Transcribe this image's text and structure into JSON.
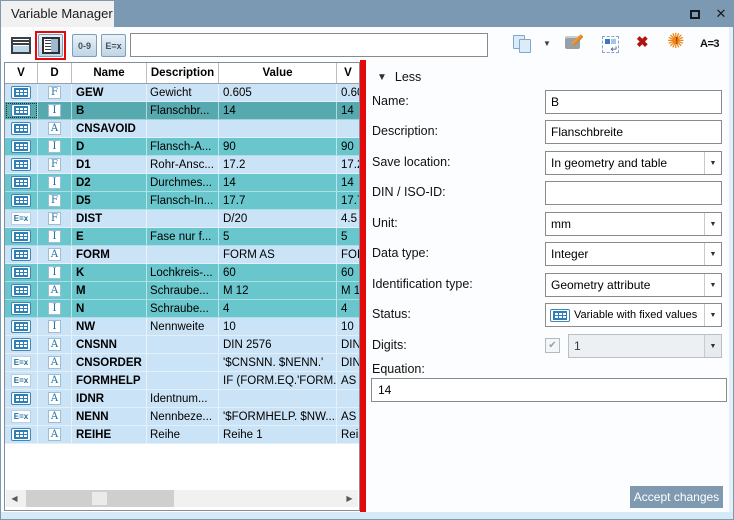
{
  "window": {
    "title": "Variable Manager",
    "close_glyph": "✕"
  },
  "toolbar": {
    "numeric_filter_label": "0-9",
    "equation_filter_label": "E=x",
    "filter_value": "",
    "a3_label": "A=3"
  },
  "icons": {
    "eq_chip_label": "E=x",
    "copy_arrow": "▼",
    "renumber_arrow": "↵",
    "delete_glyph": "✖",
    "star_glyph": "✺",
    "star_mark": "!",
    "less_arrow": "▼",
    "dropdown_arrow": "▼",
    "check_glyph": "✔",
    "scroll_left": "◀",
    "scroll_right": "▶"
  },
  "colors": {
    "annotation_red": "#e20a0a",
    "row_blue": "#cbe3f6",
    "row_teal": "#68c6cc",
    "row_selected": "#57a9b0",
    "titlebar": "#7b99b3",
    "accept_button": "#7e99b0"
  },
  "table": {
    "columns": [
      "V",
      "D",
      "Name",
      "Description",
      "Value",
      "V"
    ],
    "rows": [
      {
        "icon": "table",
        "d": "F",
        "name": "GEW",
        "desc": "Gewicht",
        "value": "0.605",
        "v2": "0.60",
        "style": "blue"
      },
      {
        "icon": "table",
        "d": "I",
        "name": "B",
        "desc": "Flanschbr...",
        "value": "14",
        "v2": "14",
        "style": "selected"
      },
      {
        "icon": "table",
        "d": "A",
        "name": "CNSAVOID",
        "desc": "",
        "value": "",
        "v2": "",
        "style": "blue"
      },
      {
        "icon": "table",
        "d": "I",
        "name": "D",
        "desc": "Flansch-A...",
        "value": "90",
        "v2": "90",
        "style": "teal"
      },
      {
        "icon": "table",
        "d": "F",
        "name": "D1",
        "desc": "Rohr-Ansc...",
        "value": "17.2",
        "v2": "17.2",
        "style": "blue"
      },
      {
        "icon": "table",
        "d": "I",
        "name": "D2",
        "desc": "Durchmes...",
        "value": "14",
        "v2": "14",
        "style": "teal"
      },
      {
        "icon": "table",
        "d": "F",
        "name": "D5",
        "desc": "Flansch-In...",
        "value": "17.7",
        "v2": "17.7",
        "style": "teal"
      },
      {
        "icon": "eq",
        "d": "F",
        "name": "DIST",
        "desc": "",
        "value": "D/20",
        "v2": "4.5",
        "style": "blue"
      },
      {
        "icon": "table",
        "d": "I",
        "name": "E",
        "desc": "Fase nur f...",
        "value": "5",
        "v2": "5",
        "style": "teal"
      },
      {
        "icon": "table",
        "d": "A",
        "name": "FORM",
        "desc": "",
        "value": "FORM AS",
        "v2": "FOR",
        "style": "blue"
      },
      {
        "icon": "table",
        "d": "I",
        "name": "K",
        "desc": "Lochkreis-...",
        "value": "60",
        "v2": "60",
        "style": "teal"
      },
      {
        "icon": "table",
        "d": "A",
        "name": "M",
        "desc": "Schraube...",
        "value": "M 12",
        "v2": "M 1",
        "style": "teal"
      },
      {
        "icon": "table",
        "d": "I",
        "name": "N",
        "desc": "Schraube...",
        "value": "4",
        "v2": "4",
        "style": "teal"
      },
      {
        "icon": "table",
        "d": "I",
        "name": "NW",
        "desc": "Nennweite",
        "value": "10",
        "v2": "10",
        "style": "blue"
      },
      {
        "icon": "table",
        "d": "A",
        "name": "CNSNN",
        "desc": "",
        "value": "DIN 2576",
        "v2": "DIN",
        "style": "blue"
      },
      {
        "icon": "eq",
        "d": "A",
        "name": "CNSORDER",
        "desc": "",
        "value": "'$CNSNN. $NENN.'",
        "v2": "DIN",
        "style": "blue"
      },
      {
        "icon": "eq",
        "d": "A",
        "name": "FORMHELP",
        "desc": "",
        "value": "IF (FORM.EQ.'FORM...",
        "v2": "AS",
        "style": "blue"
      },
      {
        "icon": "table",
        "d": "A",
        "name": "IDNR",
        "desc": "Identnum...",
        "value": "",
        "v2": "",
        "style": "blue"
      },
      {
        "icon": "eq",
        "d": "A",
        "name": "NENN",
        "desc": "Nennbeze...",
        "value": "'$FORMHELP. $NW....",
        "v2": "AS 1",
        "style": "blue"
      },
      {
        "icon": "table",
        "d": "A",
        "name": "REIHE",
        "desc": "Reihe",
        "value": "Reihe 1",
        "v2": "Reih",
        "style": "blue"
      }
    ]
  },
  "form": {
    "less_label": "Less",
    "name": {
      "label": "Name:",
      "value": "B"
    },
    "description": {
      "label": "Description:",
      "value": "Flanschbreite"
    },
    "save_location": {
      "label": "Save location:",
      "value": "In geometry and table"
    },
    "din_iso": {
      "label": "DIN / ISO-ID:",
      "value": ""
    },
    "unit": {
      "label": "Unit:",
      "value": "mm"
    },
    "data_type": {
      "label": "Data type:",
      "value": "Integer"
    },
    "identification_type": {
      "label": "Identification type:",
      "value": "Geometry attribute"
    },
    "status": {
      "label": "Status:",
      "value": "Variable with fixed values"
    },
    "digits": {
      "label": "Digits:",
      "value": "1",
      "checked": true
    },
    "equation": {
      "label": "Equation:",
      "value": "14"
    },
    "accept_label": "Accept changes"
  }
}
